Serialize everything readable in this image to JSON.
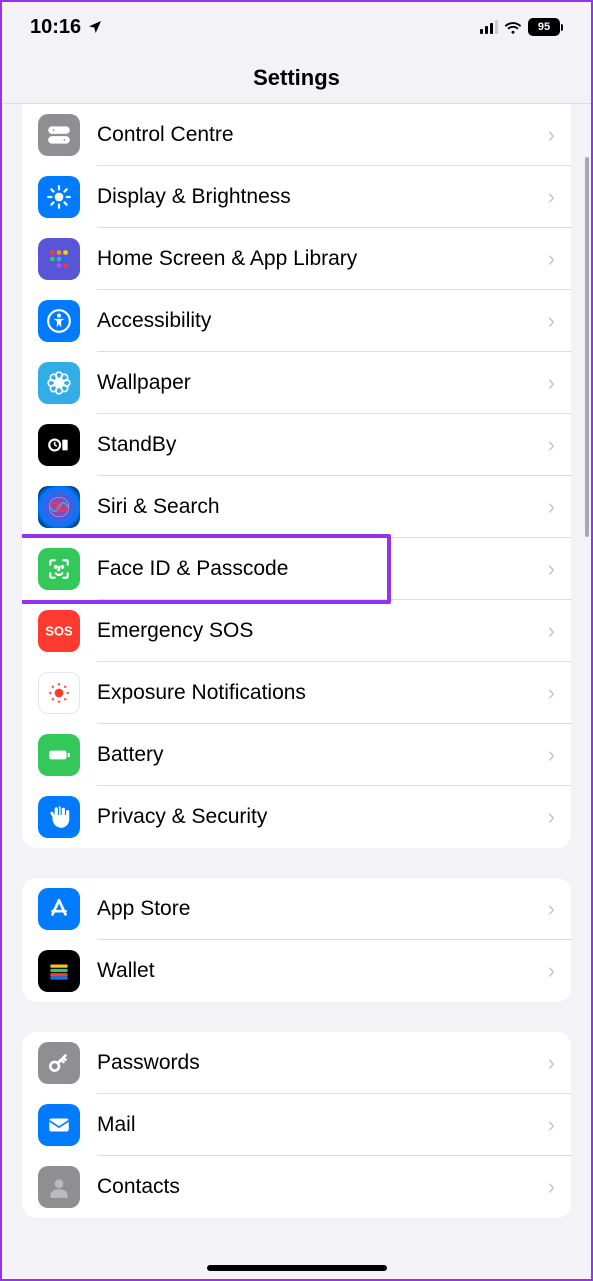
{
  "statusBar": {
    "time": "10:16",
    "battery": "95"
  },
  "header": {
    "title": "Settings"
  },
  "groups": [
    {
      "items": [
        {
          "id": "control-centre",
          "label": "Control Centre",
          "icon": "toggles",
          "bg": "bg-grey"
        },
        {
          "id": "display-brightness",
          "label": "Display & Brightness",
          "icon": "sun",
          "bg": "bg-blue"
        },
        {
          "id": "home-screen",
          "label": "Home Screen & App Library",
          "icon": "grid",
          "bg": "bg-indigo"
        },
        {
          "id": "accessibility",
          "label": "Accessibility",
          "icon": "accessibility",
          "bg": "bg-blue"
        },
        {
          "id": "wallpaper",
          "label": "Wallpaper",
          "icon": "flower",
          "bg": "bg-cyan"
        },
        {
          "id": "standby",
          "label": "StandBy",
          "icon": "standby",
          "bg": "bg-black"
        },
        {
          "id": "siri-search",
          "label": "Siri & Search",
          "icon": "siri",
          "bg": "bg-siri"
        },
        {
          "id": "face-id",
          "label": "Face ID & Passcode",
          "icon": "faceid",
          "bg": "bg-green",
          "highlight": true
        },
        {
          "id": "emergency-sos",
          "label": "Emergency SOS",
          "icon": "sos",
          "bg": "bg-red"
        },
        {
          "id": "exposure",
          "label": "Exposure Notifications",
          "icon": "exposure",
          "bg": "bg-white-outline"
        },
        {
          "id": "battery",
          "label": "Battery",
          "icon": "battery",
          "bg": "bg-green"
        },
        {
          "id": "privacy",
          "label": "Privacy & Security",
          "icon": "hand",
          "bg": "bg-blue"
        }
      ]
    },
    {
      "items": [
        {
          "id": "app-store",
          "label": "App Store",
          "icon": "appstore",
          "bg": "bg-blue"
        },
        {
          "id": "wallet",
          "label": "Wallet",
          "icon": "wallet",
          "bg": "bg-wallet"
        }
      ]
    },
    {
      "items": [
        {
          "id": "passwords",
          "label": "Passwords",
          "icon": "key",
          "bg": "bg-grey"
        },
        {
          "id": "mail",
          "label": "Mail",
          "icon": "mail",
          "bg": "bg-blue"
        },
        {
          "id": "contacts",
          "label": "Contacts",
          "icon": "contacts",
          "bg": "bg-grey"
        }
      ]
    }
  ]
}
